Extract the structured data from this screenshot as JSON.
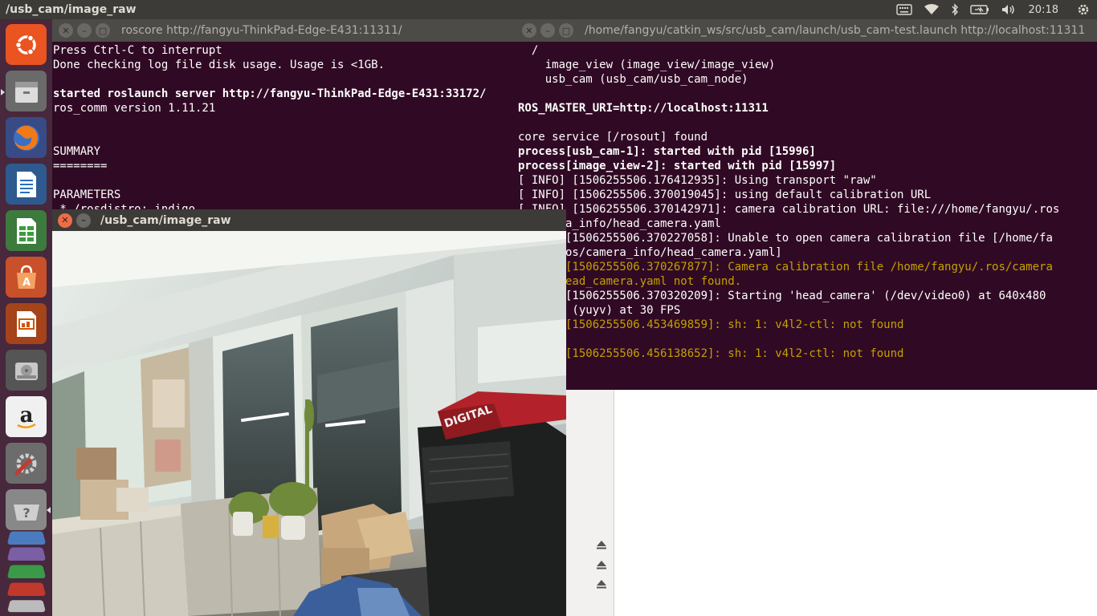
{
  "top_panel": {
    "title": "/usb_cam/image_raw",
    "clock": "20:18",
    "indicators": [
      "keyboard-icon",
      "wifi-icon",
      "bluetooth-icon",
      "battery-icon",
      "volume-icon",
      "power-gear-icon"
    ]
  },
  "launcher": {
    "items": [
      {
        "name": "ubuntu-dash-icon",
        "color": "#e95420"
      },
      {
        "name": "files-icon",
        "color": "#8a8a8a"
      },
      {
        "name": "firefox-icon",
        "color": "#e66000"
      },
      {
        "name": "writer-icon",
        "color": "#2a6ebb"
      },
      {
        "name": "calc-icon",
        "color": "#3c9d3c"
      },
      {
        "name": "software-center-icon",
        "color": "#e95420"
      },
      {
        "name": "impress-icon",
        "color": "#d35400"
      },
      {
        "name": "disks-icon",
        "color": "#9a9a9a"
      },
      {
        "name": "amazon-icon",
        "color": "#ffffff"
      },
      {
        "name": "system-settings-icon",
        "color": "#c8392b"
      },
      {
        "name": "help-icon",
        "color": "#9a9a9a"
      }
    ]
  },
  "roscore_window": {
    "title": "roscore http://fangyu-ThinkPad-Edge-E431:11311/",
    "lines": [
      {
        "text": "Press Ctrl-C to interrupt",
        "style": ""
      },
      {
        "text": "Done checking log file disk usage. Usage is <1GB.",
        "style": ""
      },
      {
        "text": "",
        "style": ""
      },
      {
        "text": "started roslaunch server http://fangyu-ThinkPad-Edge-E431:33172/",
        "style": "b"
      },
      {
        "text": "ros_comm version 1.11.21",
        "style": ""
      },
      {
        "text": "",
        "style": ""
      },
      {
        "text": "",
        "style": ""
      },
      {
        "text": "SUMMARY",
        "style": ""
      },
      {
        "text": "========",
        "style": ""
      },
      {
        "text": "",
        "style": ""
      },
      {
        "text": "PARAMETERS",
        "style": ""
      },
      {
        "text": " * /rosdistro: indigo",
        "style": ""
      }
    ]
  },
  "launch_window": {
    "title": "/home/fangyu/catkin_ws/src/usb_cam/launch/usb_cam-test.launch http://localhost:11311",
    "lines": [
      {
        "text": "  /",
        "style": ""
      },
      {
        "text": "    image_view (image_view/image_view)",
        "style": ""
      },
      {
        "text": "    usb_cam (usb_cam/usb_cam_node)",
        "style": ""
      },
      {
        "text": "",
        "style": ""
      },
      {
        "text": "ROS_MASTER_URI=http://localhost:11311",
        "style": "b"
      },
      {
        "text": "",
        "style": ""
      },
      {
        "text": "core service [/rosout] found",
        "style": ""
      },
      {
        "text": "process[usb_cam-1]: started with pid [15996]",
        "style": "b"
      },
      {
        "text": "process[image_view-2]: started with pid [15997]",
        "style": "b"
      },
      {
        "text": "[ INFO] [1506255506.176412935]: Using transport \"raw\"",
        "style": ""
      },
      {
        "text": "[ INFO] [1506255506.370019045]: using default calibration URL",
        "style": ""
      },
      {
        "text": "[ INFO] [1506255506.370142971]: camera calibration URL: file:///home/fangyu/.ros",
        "style": ""
      },
      {
        "text": "       a_info/head_camera.yaml",
        "style": ""
      },
      {
        "text": "       [1506255506.370227058]: Unable to open camera calibration file [/home/fa",
        "style": ""
      },
      {
        "text": "      ros/camera_info/head_camera.yaml]",
        "style": ""
      },
      {
        "text": "       [1506255506.370267877]: Camera calibration file /home/fangyu/.ros/camera",
        "style": "warn"
      },
      {
        "text": "      head_camera.yaml not found.",
        "style": "warn"
      },
      {
        "text": "       [1506255506.370320209]: Starting 'head_camera' (/dev/video0) at 640x480",
        "style": ""
      },
      {
        "text": "      p (yuyv) at 30 FPS",
        "style": ""
      },
      {
        "text": "       [1506255506.453469859]: sh: 1: v4l2-ctl: not found",
        "style": "warn"
      },
      {
        "text": "",
        "style": ""
      },
      {
        "text": "       [1506255506.456138652]: sh: 1: v4l2-ctl: not found",
        "style": "warn"
      }
    ]
  },
  "image_window": {
    "title": "/usb_cam/image_raw",
    "sign_text": "DIGITAL"
  }
}
